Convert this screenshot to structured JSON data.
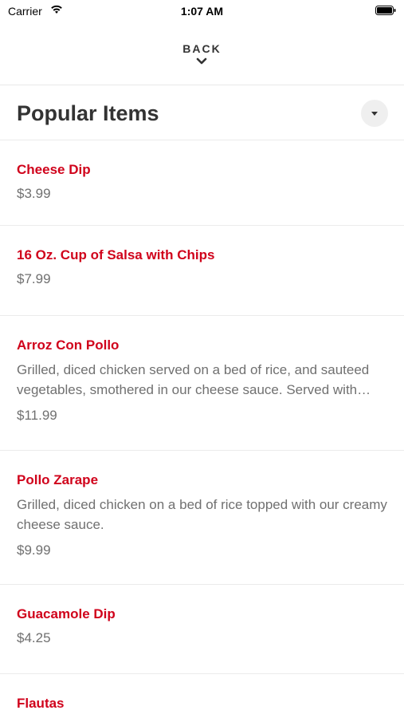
{
  "status_bar": {
    "carrier": "Carrier",
    "time": "1:07 AM"
  },
  "header": {
    "back_label": "BACK"
  },
  "section": {
    "title": "Popular Items"
  },
  "items": [
    {
      "name": "Cheese Dip",
      "price": "$3.99"
    },
    {
      "name": "16 Oz. Cup of Salsa with Chips",
      "price": "$7.99"
    },
    {
      "name": "Arroz Con Pollo",
      "description": "Grilled, diced chicken served on a bed of rice, and sauteed vegetables, smothered in our cheese sauce. Served with…",
      "price": "$11.99"
    },
    {
      "name": "Pollo Zarape",
      "description": "Grilled, diced chicken on a bed of rice topped with our creamy cheese sauce.",
      "price": "$9.99"
    },
    {
      "name": "Guacamole Dip",
      "price": "$4.25"
    },
    {
      "name": "Flautas"
    }
  ],
  "colors": {
    "item_name": "#d0021b",
    "secondary_text": "#707070",
    "divider": "#ebebeb"
  }
}
